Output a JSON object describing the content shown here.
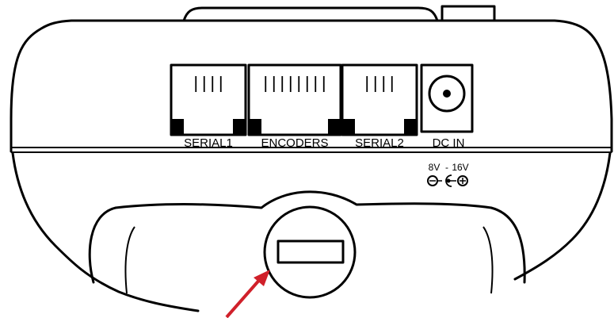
{
  "ports": [
    {
      "id": "serial1",
      "label": "SERIAL1",
      "pins": 4
    },
    {
      "id": "encoders",
      "label": "ENCODERS",
      "pins": 8
    },
    {
      "id": "serial2",
      "label": "SERIAL2",
      "pins": 4
    }
  ],
  "power": {
    "label": "DC IN",
    "voltage_low": "8V",
    "voltage_sep": "-",
    "voltage_high": "16V"
  },
  "colors": {
    "outline": "#000000",
    "arrow": "#d0202a",
    "background": "#ffffff"
  }
}
